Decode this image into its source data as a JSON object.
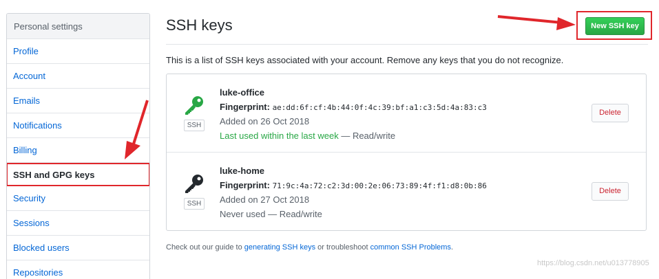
{
  "sidebar": {
    "header": "Personal settings",
    "items": [
      {
        "label": "Profile"
      },
      {
        "label": "Account"
      },
      {
        "label": "Emails"
      },
      {
        "label": "Notifications"
      },
      {
        "label": "Billing"
      },
      {
        "label": "SSH and GPG keys",
        "selected": true
      },
      {
        "label": "Security"
      },
      {
        "label": "Sessions"
      },
      {
        "label": "Blocked users"
      },
      {
        "label": "Repositories"
      }
    ]
  },
  "main": {
    "title": "SSH keys",
    "new_key_button": "New SSH key",
    "intro": "This is a list of SSH keys associated with your account. Remove any keys that you do not recognize.",
    "keys": [
      {
        "name": "luke-office",
        "fingerprint_label": "Fingerprint:",
        "fingerprint": "ae:dd:6f:cf:4b:44:0f:4c:39:bf:a1:c3:5d:4a:83:c3",
        "added": "Added on 26 Oct 2018",
        "last_used": "Last used within the last week",
        "access": " — Read/write",
        "tag": "SSH",
        "icon": "key-icon",
        "icon_color": "#28a745",
        "delete_label": "Delete"
      },
      {
        "name": "luke-home",
        "fingerprint_label": "Fingerprint:",
        "fingerprint": "71:9c:4a:72:c2:3d:00:2e:06:73:89:4f:f1:d8:0b:86",
        "added": "Added on 27 Oct 2018",
        "last_used": "Never used",
        "access": " — Read/write",
        "tag": "SSH",
        "icon": "key-icon",
        "icon_color": "#24292e",
        "delete_label": "Delete"
      }
    ],
    "footer": {
      "prefix": "Check out our guide to ",
      "link1": "generating SSH keys",
      "middle": " or troubleshoot ",
      "link2": "common SSH Problems",
      "suffix": "."
    }
  },
  "watermark": "https://blog.csdn.net/u013778905",
  "colors": {
    "accent_link": "#0366d6",
    "primary_button": "#28a745",
    "danger": "#cb2431",
    "annotation": "#e0262b"
  }
}
